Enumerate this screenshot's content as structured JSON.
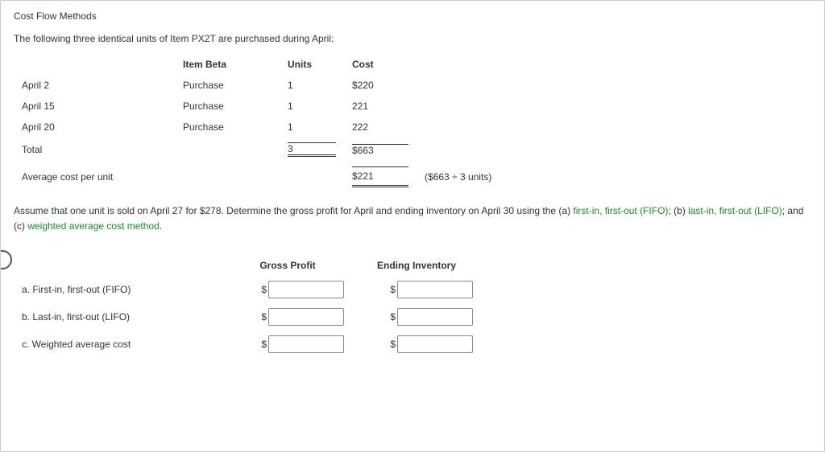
{
  "title": "Cost Flow Methods",
  "intro": "The following three identical units of Item PX2T are purchased during April:",
  "purchase_table": {
    "headers": {
      "item": "Item Beta",
      "units": "Units",
      "cost": "Cost"
    },
    "rows": [
      {
        "date": "April 2",
        "type": "Purchase",
        "units": "1",
        "cost": "$220"
      },
      {
        "date": "April 15",
        "type": "Purchase",
        "units": "1",
        "cost": "221"
      },
      {
        "date": "April 20",
        "type": "Purchase",
        "units": "1",
        "cost": "222"
      }
    ],
    "total": {
      "label": "Total",
      "units": "3",
      "cost": "$663"
    },
    "average": {
      "label": "Average cost per unit",
      "cost": "$221",
      "note": "($663 ÷ 3 units)"
    }
  },
  "instructions": {
    "pre": "Assume that one unit is sold on April 27 for $278. Determine the gross profit for April and ending inventory on April 30 using the (a) ",
    "fifo": "first-in, first-out (FIFO)",
    "mid1": "; (b) ",
    "lifo": "last-in, first-out (LIFO)",
    "mid2": "; and (c) ",
    "wavg": "weighted average cost method",
    "post": "."
  },
  "answer_headers": {
    "gp": "Gross Profit",
    "ei": "Ending Inventory"
  },
  "answer_rows": [
    {
      "label": "a. First-in, first-out (FIFO)"
    },
    {
      "label": "b. Last-in, first-out (LIFO)"
    },
    {
      "label": "c. Weighted average cost"
    }
  ],
  "dollar": "$"
}
